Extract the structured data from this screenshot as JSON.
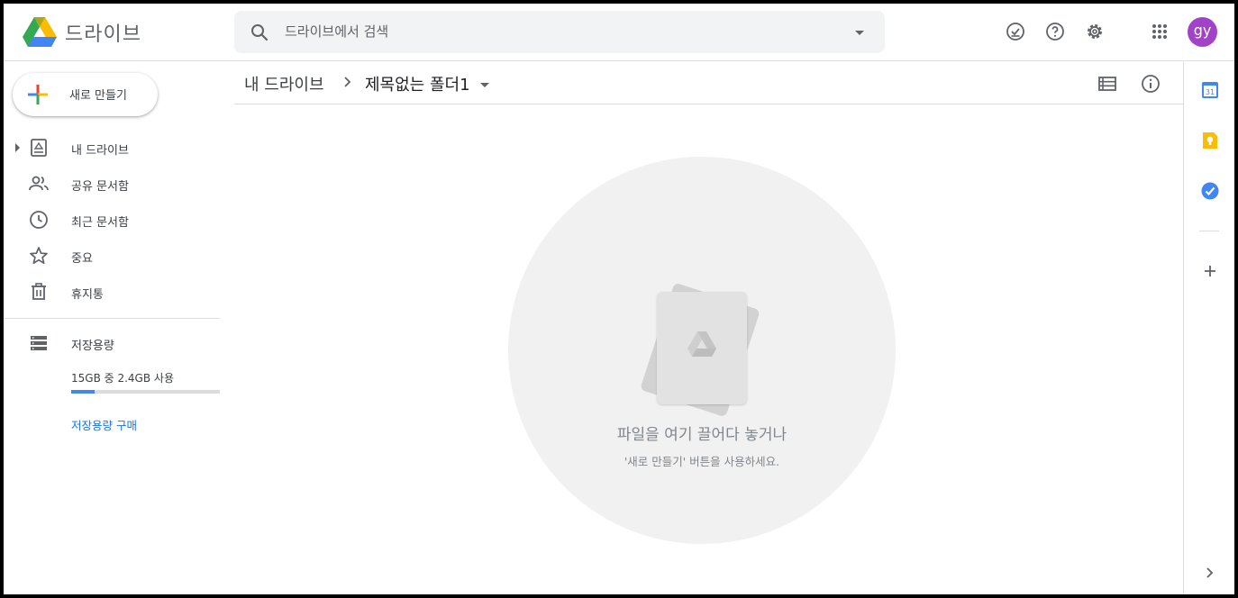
{
  "header": {
    "app_title": "드라이브",
    "search_placeholder": "드라이브에서 검색",
    "avatar_initials": "gy"
  },
  "sidebar": {
    "new_label": "새로 만들기",
    "items": [
      {
        "label": "내 드라이브",
        "icon": "my-drive-icon"
      },
      {
        "label": "공유 문서함",
        "icon": "people-icon"
      },
      {
        "label": "최근 문서함",
        "icon": "clock-icon"
      },
      {
        "label": "중요",
        "icon": "star-icon"
      },
      {
        "label": "휴지통",
        "icon": "trash-icon"
      },
      {
        "label": "저장용량",
        "icon": "storage-icon"
      }
    ],
    "storage_text": "15GB 중 2.4GB 사용",
    "storage_used_fraction": 0.16,
    "buy_storage_label": "저장용량 구매"
  },
  "breadcrumb": {
    "root": "내 드라이브",
    "current": "제목없는 폴더1"
  },
  "empty_state": {
    "title": "파일을 여기 끌어다 놓거나",
    "subtitle": "'새로 만들기' 버튼을 사용하세요."
  },
  "side_panel": {
    "calendar_day": "31"
  },
  "colors": {
    "accent_blue": "#1a73e8",
    "avatar": "#a142c9",
    "storage_fill": "#4285f4"
  }
}
